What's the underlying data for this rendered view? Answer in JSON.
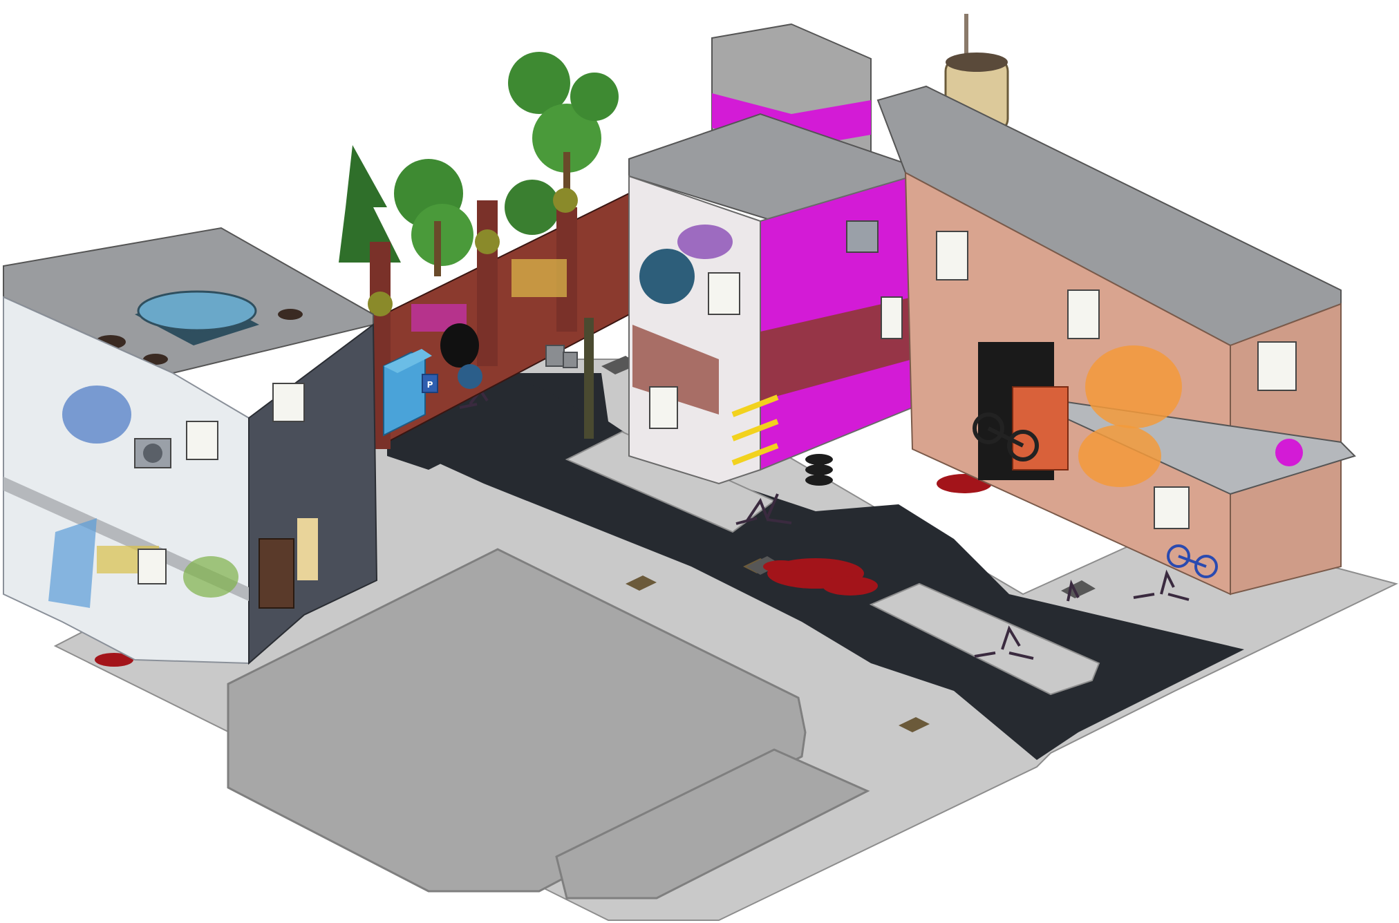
{
  "scene": {
    "kind": "isometric-room",
    "theme": "abandoned-city-street",
    "palette": {
      "background": "#ffffff",
      "asphalt": "#262a30",
      "sidewalk": "#c9c9c9",
      "sidewalk_dark": "#9a9a9a",
      "plaza": "#a7a7a7",
      "brick_dark": "#7a3a2e",
      "brick_light": "#d9a48f",
      "tile_white": "#e8ecef",
      "stone_dark": "#4a4f5a",
      "roof": "#9a9c9f",
      "neon_magenta": "#d31bd6",
      "graffiti_orange": "#f39a3b",
      "graffiti_blue": "#5b86c9",
      "tree_green": "#3e8a32",
      "blood": "#a3141a"
    },
    "icons": [
      "parking-sign-icon",
      "bus-shelter-icon",
      "water-tower-icon",
      "motorcycle-icon",
      "bicycle-icon",
      "tire-stack-icon",
      "trash-can-icon",
      "manhole-cover-icon",
      "blood-splatter-icon",
      "street-crack-icon",
      "caution-tape-icon",
      "ventilation-fan-icon",
      "pine-tree-icon",
      "lamp-icon"
    ],
    "signs": {
      "parking": "P"
    }
  }
}
